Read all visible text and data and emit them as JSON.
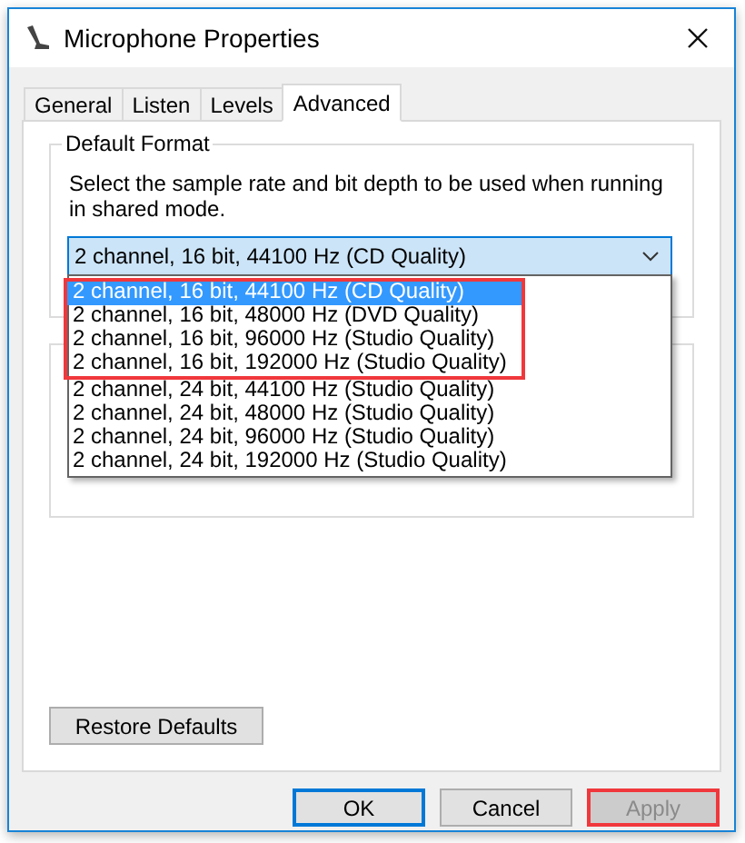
{
  "window": {
    "title": "Microphone Properties"
  },
  "tabs": [
    {
      "label": "General",
      "selected": false
    },
    {
      "label": "Listen",
      "selected": false
    },
    {
      "label": "Levels",
      "selected": false
    },
    {
      "label": "Advanced",
      "selected": true
    }
  ],
  "default_format": {
    "title": "Default Format",
    "description": "Select the sample rate and bit depth to be used when running in shared mode.",
    "value": "2 channel, 16 bit, 44100 Hz (CD Quality)",
    "expanded": true,
    "options": [
      {
        "label": "2 channel, 16 bit, 44100 Hz (CD Quality)",
        "selected": true,
        "highlighted": true
      },
      {
        "label": "2 channel, 16 bit, 48000 Hz (DVD Quality)",
        "selected": false,
        "highlighted": true
      },
      {
        "label": "2 channel, 16 bit, 96000 Hz (Studio Quality)",
        "selected": false,
        "highlighted": true
      },
      {
        "label": "2 channel, 16 bit, 192000 Hz (Studio Quality)",
        "selected": false,
        "highlighted": true
      },
      {
        "label": "2 channel, 24 bit, 44100 Hz (Studio Quality)",
        "selected": false,
        "highlighted": false
      },
      {
        "label": "2 channel, 24 bit, 48000 Hz (Studio Quality)",
        "selected": false,
        "highlighted": false
      },
      {
        "label": "2 channel, 24 bit, 96000 Hz (Studio Quality)",
        "selected": false,
        "highlighted": false
      },
      {
        "label": "2 channel, 24 bit, 192000 Hz (Studio Quality)",
        "selected": false,
        "highlighted": false
      }
    ]
  },
  "restore_button": "Restore Defaults",
  "buttons": [
    {
      "label": "OK",
      "default": true,
      "disabled": false,
      "highlighted": false
    },
    {
      "label": "Cancel",
      "default": false,
      "disabled": false,
      "highlighted": false
    },
    {
      "label": "Apply",
      "default": false,
      "disabled": true,
      "highlighted": true
    }
  ]
}
